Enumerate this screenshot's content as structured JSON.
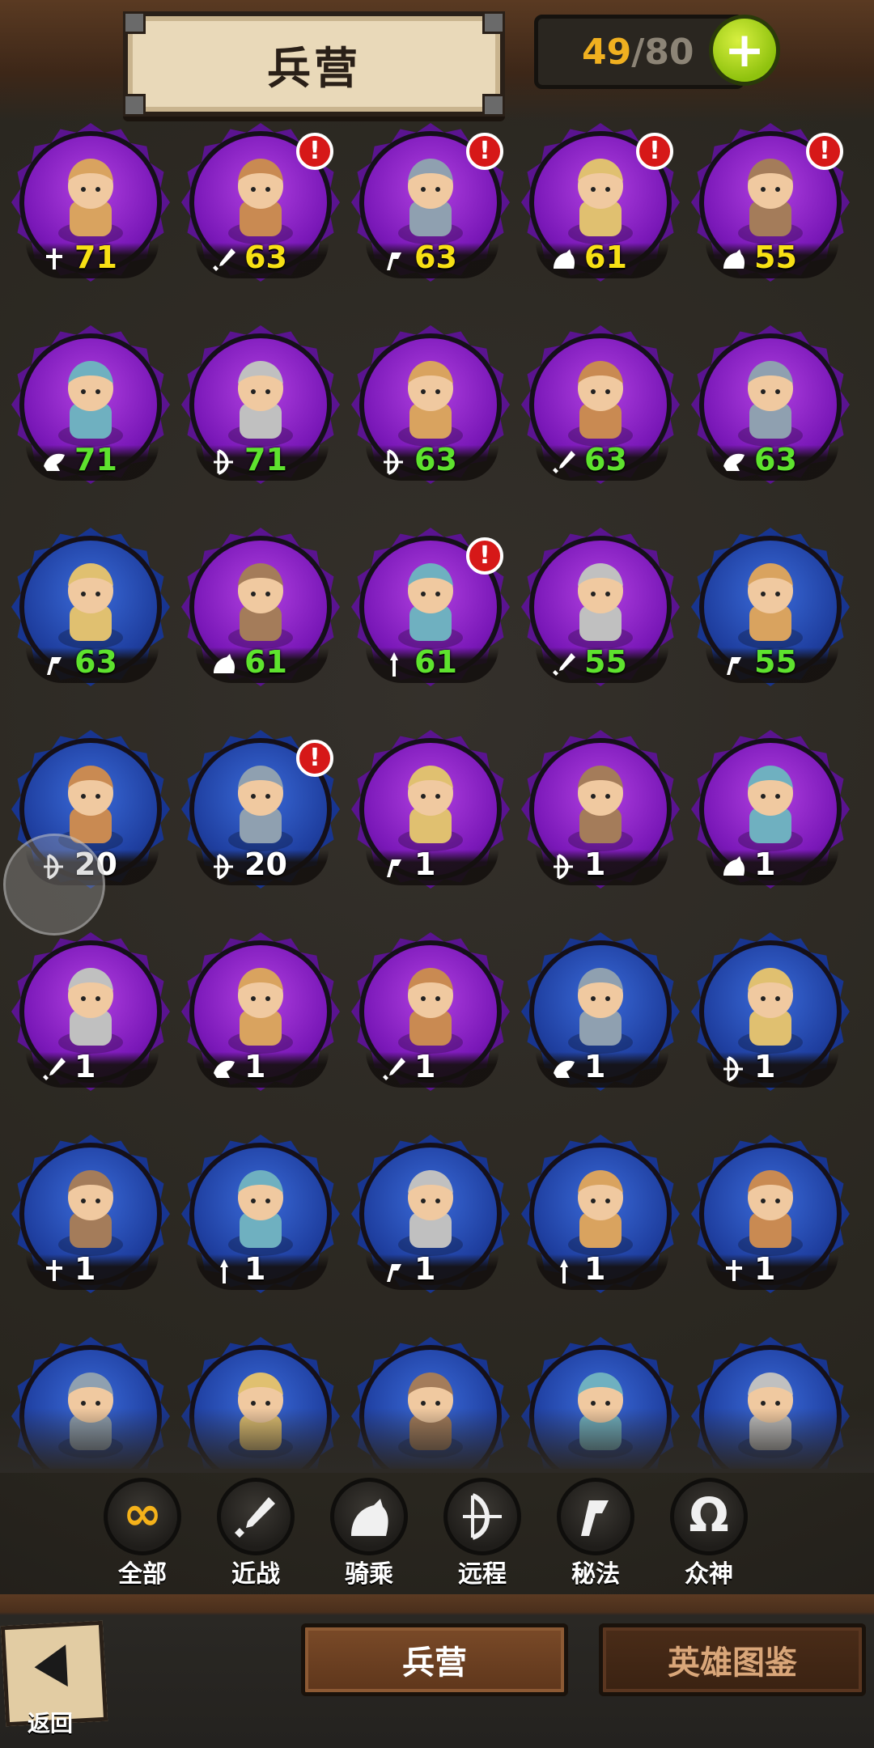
{
  "header": {
    "title": "兵营",
    "capacity_current": "49",
    "capacity_sep": "/",
    "capacity_max": "80",
    "plus_icon": "plus-icon"
  },
  "colors": {
    "purple_frame": "#7a18b8",
    "blue_frame": "#1f3fa0",
    "level_yellow": "#f7e014",
    "level_green": "#5ee22e",
    "level_white": "#ffffff",
    "alert_red": "#d61818"
  },
  "heroes": [
    {
      "frame": "purple",
      "cls": "holy",
      "level": "71",
      "color": "y",
      "alert": false
    },
    {
      "frame": "purple",
      "cls": "melee",
      "level": "63",
      "color": "y",
      "alert": true
    },
    {
      "frame": "purple",
      "cls": "arcane",
      "level": "63",
      "color": "y",
      "alert": true
    },
    {
      "frame": "purple",
      "cls": "mounted",
      "level": "61",
      "color": "y",
      "alert": true
    },
    {
      "frame": "purple",
      "cls": "mounted",
      "level": "55",
      "color": "y",
      "alert": true
    },
    {
      "frame": "purple",
      "cls": "beast",
      "level": "71",
      "color": "g",
      "alert": false
    },
    {
      "frame": "purple",
      "cls": "ranged",
      "level": "71",
      "color": "g",
      "alert": false
    },
    {
      "frame": "purple",
      "cls": "ranged",
      "level": "63",
      "color": "g",
      "alert": false
    },
    {
      "frame": "purple",
      "cls": "melee",
      "level": "63",
      "color": "g",
      "alert": false
    },
    {
      "frame": "purple",
      "cls": "beast",
      "level": "63",
      "color": "g",
      "alert": false
    },
    {
      "frame": "blue",
      "cls": "arcane",
      "level": "63",
      "color": "g",
      "alert": false
    },
    {
      "frame": "purple",
      "cls": "mounted",
      "level": "61",
      "color": "g",
      "alert": false
    },
    {
      "frame": "purple",
      "cls": "spear",
      "level": "61",
      "color": "g",
      "alert": true
    },
    {
      "frame": "purple",
      "cls": "melee",
      "level": "55",
      "color": "g",
      "alert": false
    },
    {
      "frame": "blue",
      "cls": "arcane",
      "level": "55",
      "color": "g",
      "alert": false
    },
    {
      "frame": "blue",
      "cls": "ranged",
      "level": "20",
      "color": "w",
      "alert": false
    },
    {
      "frame": "blue",
      "cls": "ranged",
      "level": "20",
      "color": "w",
      "alert": true
    },
    {
      "frame": "purple",
      "cls": "arcane",
      "level": "1",
      "color": "w",
      "alert": false
    },
    {
      "frame": "purple",
      "cls": "ranged",
      "level": "1",
      "color": "w",
      "alert": false
    },
    {
      "frame": "purple",
      "cls": "mounted",
      "level": "1",
      "color": "w",
      "alert": false
    },
    {
      "frame": "purple",
      "cls": "melee",
      "level": "1",
      "color": "w",
      "alert": false
    },
    {
      "frame": "purple",
      "cls": "beast",
      "level": "1",
      "color": "w",
      "alert": false
    },
    {
      "frame": "purple",
      "cls": "melee",
      "level": "1",
      "color": "w",
      "alert": false
    },
    {
      "frame": "blue",
      "cls": "beast",
      "level": "1",
      "color": "w",
      "alert": false
    },
    {
      "frame": "blue",
      "cls": "ranged",
      "level": "1",
      "color": "w",
      "alert": false
    },
    {
      "frame": "blue",
      "cls": "holy",
      "level": "1",
      "color": "w",
      "alert": false
    },
    {
      "frame": "blue",
      "cls": "spear",
      "level": "1",
      "color": "w",
      "alert": false
    },
    {
      "frame": "blue",
      "cls": "arcane",
      "level": "1",
      "color": "w",
      "alert": false
    },
    {
      "frame": "blue",
      "cls": "spear",
      "level": "1",
      "color": "w",
      "alert": false
    },
    {
      "frame": "blue",
      "cls": "holy",
      "level": "1",
      "color": "w",
      "alert": false
    },
    {
      "frame": "blue",
      "cls": "",
      "level": "",
      "color": "w",
      "alert": false
    },
    {
      "frame": "blue",
      "cls": "",
      "level": "",
      "color": "w",
      "alert": false
    },
    {
      "frame": "blue",
      "cls": "",
      "level": "",
      "color": "w",
      "alert": false
    },
    {
      "frame": "blue",
      "cls": "",
      "level": "",
      "color": "w",
      "alert": false
    },
    {
      "frame": "blue",
      "cls": "",
      "level": "",
      "color": "w",
      "alert": false
    }
  ],
  "filters": [
    {
      "label": "全部",
      "icon": "infinity-icon"
    },
    {
      "label": "近战",
      "icon": "sword-icon"
    },
    {
      "label": "骑乘",
      "icon": "horse-icon"
    },
    {
      "label": "远程",
      "icon": "bow-icon"
    },
    {
      "label": "秘法",
      "icon": "rune-icon"
    },
    {
      "label": "众神",
      "icon": "omega-icon"
    }
  ],
  "tabs": {
    "barracks": "兵营",
    "codex": "英雄图鉴"
  },
  "back": {
    "label": "返回"
  }
}
